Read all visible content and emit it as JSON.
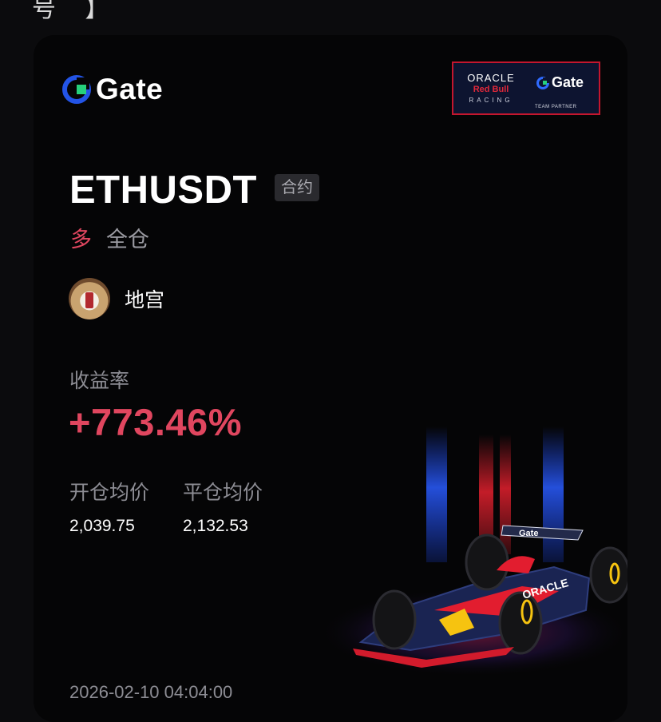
{
  "header": {
    "partial_glyphs": "号 】"
  },
  "brand": {
    "logo_text": "Gate",
    "accent_color": "#2354e6",
    "partner_badge": {
      "oracle": "ORACLE",
      "redbull": "Red Bull",
      "racing": "RACING",
      "gate": "Gate",
      "team_partner": "TEAM PARTNER"
    }
  },
  "trade": {
    "symbol": "ETHUSDT",
    "contract_tag": "合约",
    "side": "多",
    "margin_mode": "全仓",
    "side_color": "#e0465f"
  },
  "user": {
    "name": "地宫"
  },
  "pnl": {
    "label": "收益率",
    "value": "+773.46%"
  },
  "prices": {
    "open_label": "开仓均价",
    "open_value": "2,039.75",
    "close_label": "平仓均价",
    "close_value": "2,132.53"
  },
  "timestamp": "2026-02-10 04:04:00",
  "icons": {
    "logo": "gate-logo-icon",
    "car": "f1-racing-car-illustration"
  }
}
